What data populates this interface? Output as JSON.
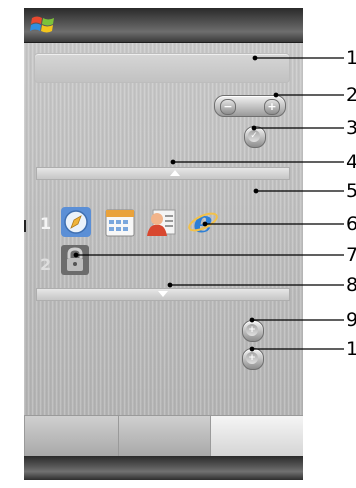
{
  "app": {
    "logo_icon": "windows-flag-icon"
  },
  "zoom_control": {
    "minus_label": "−",
    "plus_label": "+"
  },
  "rows": [
    {
      "number": "1",
      "icons": [
        "compass-icon",
        "calendar-icon",
        "contact-card-icon",
        "internet-explorer-icon"
      ]
    },
    {
      "number": "2",
      "icons": [
        "lock-icon"
      ]
    }
  ],
  "callouts": [
    "1",
    "2",
    "3",
    "4",
    "5",
    "6",
    "7",
    "8",
    "9",
    "1"
  ],
  "colors": {
    "title_bar": "#3a3a3a",
    "screen_bg": "#c0c0c0",
    "callout_line": "#000000"
  }
}
